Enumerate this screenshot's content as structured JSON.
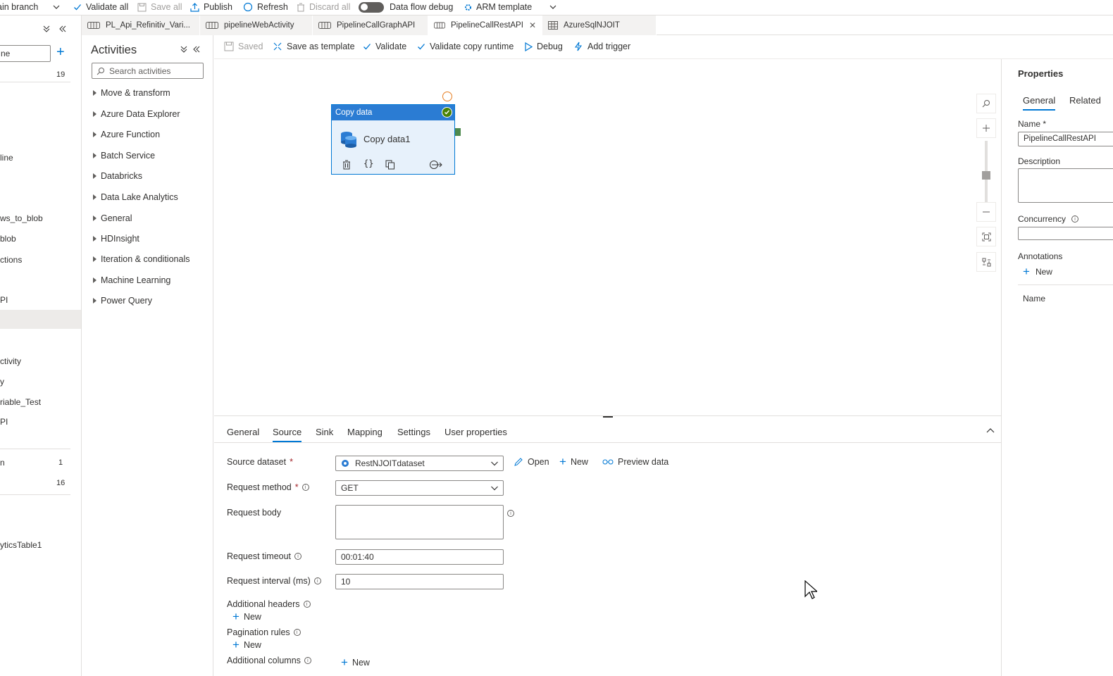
{
  "topbar": {
    "branch": "ain branch",
    "validate_all": "Validate all",
    "save_all": "Save all",
    "publish": "Publish",
    "refresh": "Refresh",
    "discard_all": "Discard all",
    "data_flow_debug": "Data flow debug",
    "arm_template": "ARM template"
  },
  "leftpane": {
    "filter_value": "ne",
    "items": [
      {
        "label": "19"
      },
      {
        "label": "line"
      },
      {
        "label": "ws_to_blob"
      },
      {
        "label": "blob"
      },
      {
        "label": "ctions"
      },
      {
        "label": "PI"
      },
      {
        "label": "ctivity"
      },
      {
        "label": "y"
      },
      {
        "label": "riable_Test"
      },
      {
        "label": "PI"
      },
      {
        "label": "n"
      },
      {
        "label": "1"
      },
      {
        "label": "16"
      },
      {
        "label": "yticsTable1"
      }
    ]
  },
  "tabs": [
    {
      "label": "PL_Api_Refinitiv_Vari..."
    },
    {
      "label": "pipelineWebActivity"
    },
    {
      "label": "PipelineCallGraphAPI"
    },
    {
      "label": "PipelineCallRestAPI"
    },
    {
      "label": "AzureSqlNJOIT"
    }
  ],
  "activities": {
    "title": "Activities",
    "search_placeholder": "Search activities",
    "categories": [
      "Move & transform",
      "Azure Data Explorer",
      "Azure Function",
      "Batch Service",
      "Databricks",
      "Data Lake Analytics",
      "General",
      "HDInsight",
      "Iteration & conditionals",
      "Machine Learning",
      "Power Query"
    ]
  },
  "canvas_toolbar": {
    "saved": "Saved",
    "save_as_template": "Save as template",
    "validate": "Validate",
    "validate_copy_runtime": "Validate copy runtime",
    "debug": "Debug",
    "add_trigger": "Add trigger"
  },
  "node": {
    "type": "Copy data",
    "name": "Copy data1"
  },
  "properties": {
    "title": "Properties",
    "tab_general": "General",
    "tab_related": "Related",
    "name_label": "Name *",
    "name_value": "PipelineCallRestAPI",
    "description_label": "Description",
    "concurrency_label": "Concurrency",
    "annotations_label": "Annotations",
    "new_label": "New",
    "name_column": "Name"
  },
  "bottom": {
    "tabs": [
      "General",
      "Source",
      "Sink",
      "Mapping",
      "Settings",
      "User properties"
    ],
    "source_dataset_label": "Source dataset",
    "source_dataset_value": "RestNJOITdataset",
    "open": "Open",
    "new": "New",
    "preview_data": "Preview data",
    "request_method_label": "Request method",
    "request_method_value": "GET",
    "request_body_label": "Request body",
    "request_timeout_label": "Request timeout",
    "request_timeout_value": "00:01:40",
    "request_interval_label": "Request interval (ms)",
    "request_interval_value": "10",
    "additional_headers_label": "Additional headers",
    "pagination_rules_label": "Pagination rules",
    "additional_columns_label": "Additional columns",
    "new_label": "New"
  },
  "colors": {
    "accent": "#0078d4",
    "node_header": "#2b7cd3",
    "success": "#498205"
  }
}
